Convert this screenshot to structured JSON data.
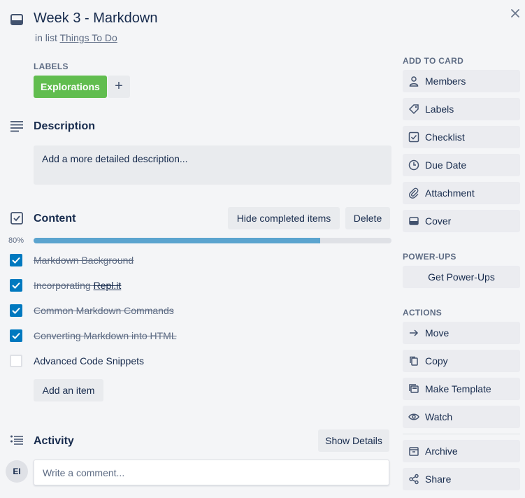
{
  "header": {
    "title": "Week 3 - Markdown",
    "in_list_prefix": "in list",
    "list_name": "Things To Do"
  },
  "labels": {
    "heading": "LABELS",
    "items": [
      {
        "text": "Explorations",
        "color": "#61bd4f"
      }
    ],
    "add_glyph": "+"
  },
  "description": {
    "heading": "Description",
    "placeholder": "Add a more detailed description..."
  },
  "checklist": {
    "heading": "Content",
    "hide_button": "Hide completed items",
    "delete_button": "Delete",
    "progress_label": "80%",
    "progress_fraction": 0.8,
    "items": [
      {
        "text": "Markdown Background",
        "checked": true
      },
      {
        "text": "Incorporating ",
        "link": "Repl.it",
        "checked": true
      },
      {
        "text": "Common Markdown Commands",
        "checked": true
      },
      {
        "text": "Converting Markdown into HTML",
        "checked": true
      },
      {
        "text": "Advanced Code Snippets",
        "checked": false
      }
    ],
    "add_item_button": "Add an item"
  },
  "activity": {
    "heading": "Activity",
    "show_details_button": "Show Details",
    "avatar_initials": "EI",
    "comment_placeholder": "Write a comment..."
  },
  "sidebar": {
    "add_to_card": {
      "heading": "ADD TO CARD",
      "items": [
        {
          "label": "Members",
          "icon": "person-icon"
        },
        {
          "label": "Labels",
          "icon": "tag-icon"
        },
        {
          "label": "Checklist",
          "icon": "checklist-icon"
        },
        {
          "label": "Due Date",
          "icon": "clock-icon"
        },
        {
          "label": "Attachment",
          "icon": "paperclip-icon"
        },
        {
          "label": "Cover",
          "icon": "cover-icon"
        }
      ]
    },
    "power_ups": {
      "heading": "POWER-UPS",
      "button": "Get Power-Ups"
    },
    "actions": {
      "heading": "ACTIONS",
      "items": [
        {
          "label": "Move",
          "icon": "arrow-right-icon"
        },
        {
          "label": "Copy",
          "icon": "copy-icon"
        },
        {
          "label": "Make Template",
          "icon": "template-icon"
        },
        {
          "label": "Watch",
          "icon": "eye-icon"
        },
        {
          "label": "Archive",
          "icon": "archive-icon"
        },
        {
          "label": "Share",
          "icon": "share-icon"
        }
      ]
    }
  },
  "colors": {
    "accent_blue": "#0079bf",
    "progress": "#5ba4cf",
    "label_green": "#61bd4f",
    "background": "#f4f5f7"
  }
}
